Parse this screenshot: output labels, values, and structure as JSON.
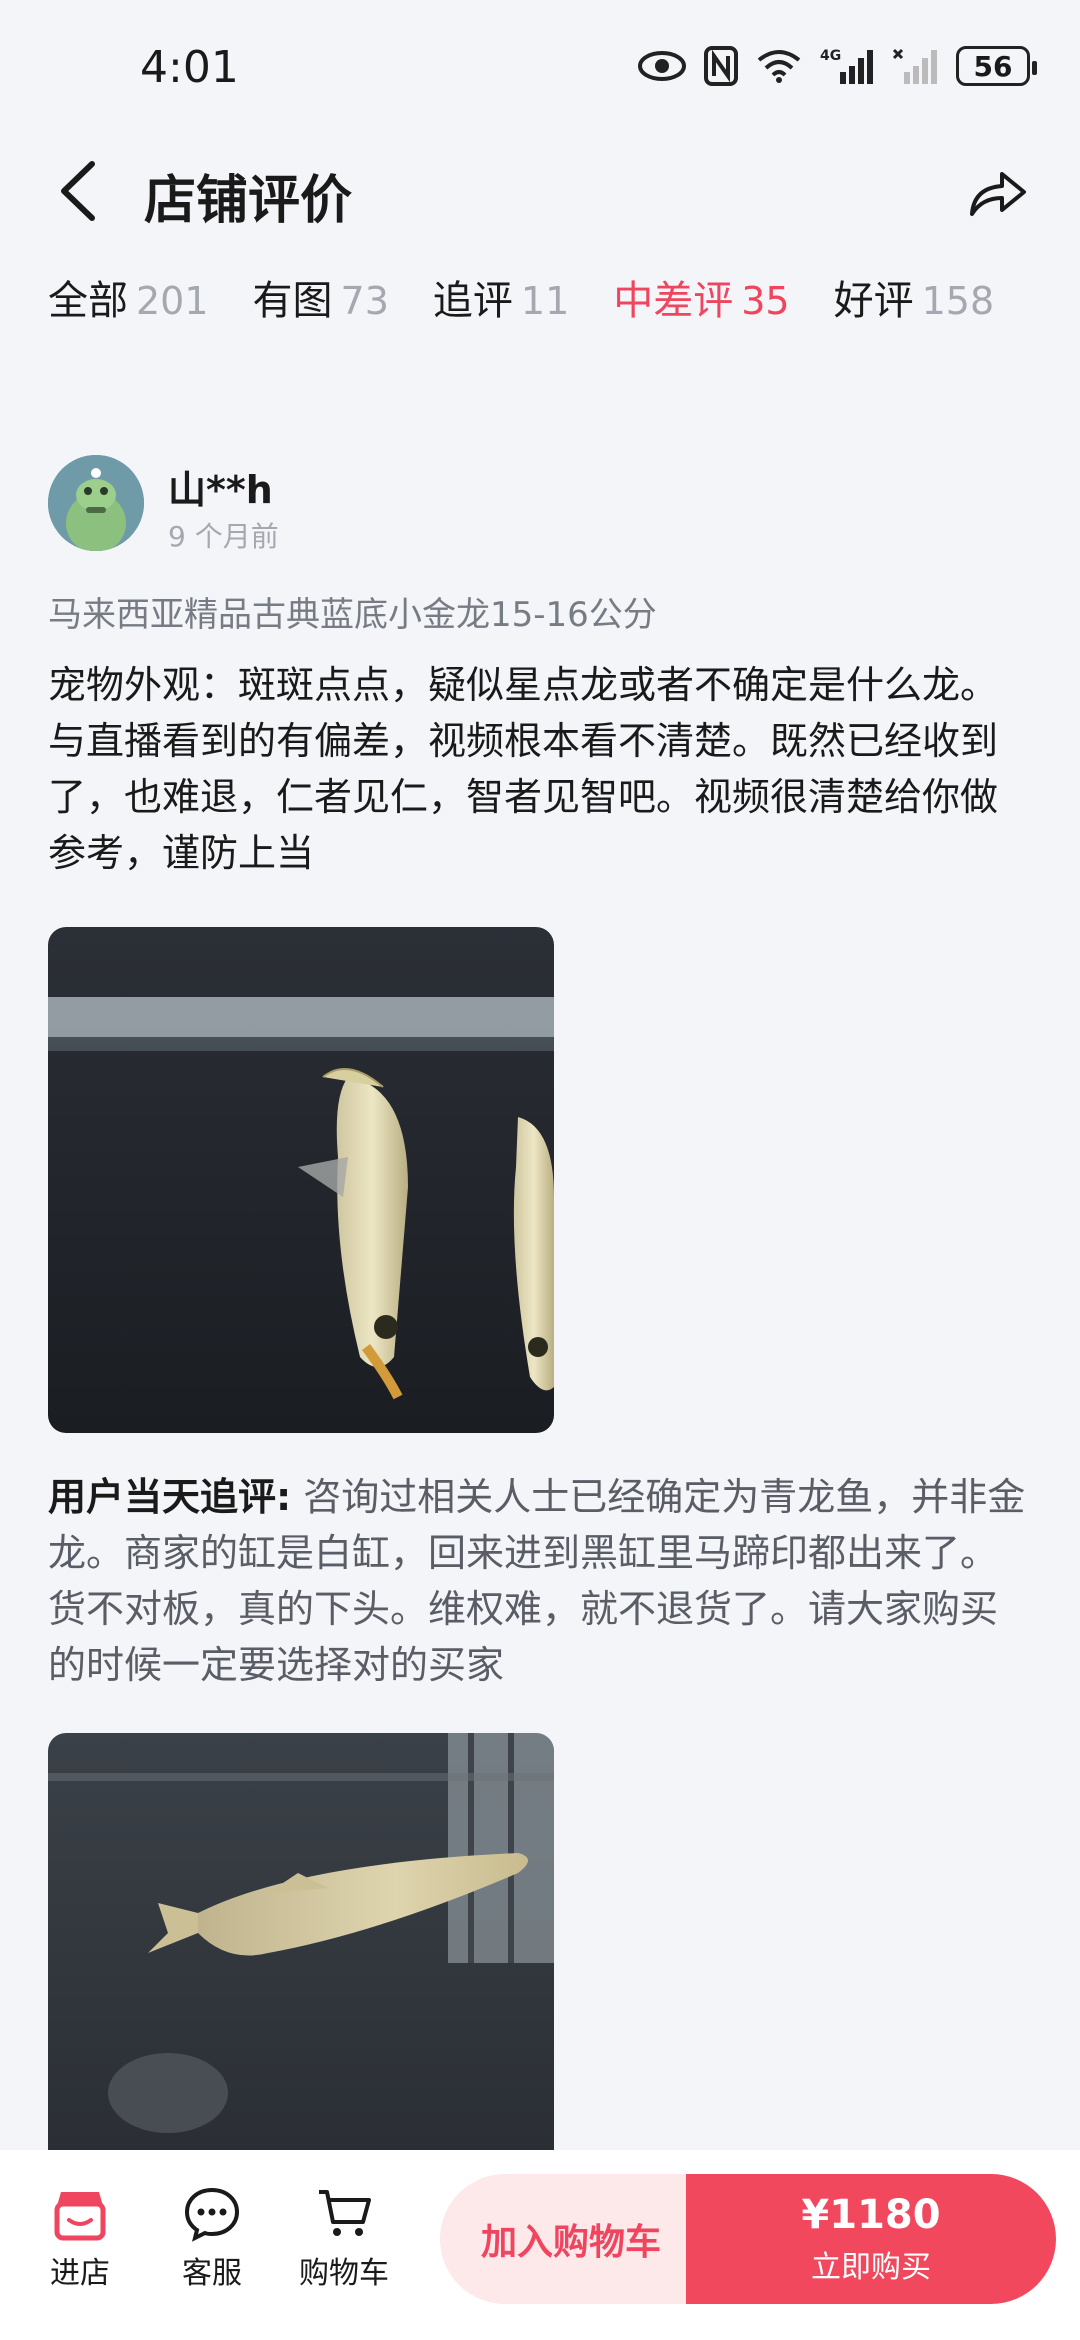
{
  "status_bar": {
    "time": "4:01",
    "battery": "56",
    "network": "4G"
  },
  "header": {
    "title": "店铺评价"
  },
  "tabs": [
    {
      "label": "全部",
      "count": "201"
    },
    {
      "label": "有图",
      "count": "73"
    },
    {
      "label": "追评",
      "count": "11"
    },
    {
      "label": "中差评",
      "count": "35",
      "active": true
    },
    {
      "label": "好评",
      "count": "158"
    }
  ],
  "review": {
    "username": "山**h",
    "time": "9 个月前",
    "sku": "马来西亚精品古典蓝底小金龙15-16公分",
    "content": "宠物外观：斑斑点点，疑似星点龙或者不确定是什么龙。与直播看到的有偏差，视频根本看不清楚。既然已经收到了，也难退，仁者见仁，智者见智吧。视频很清楚给你做参考，谨防上当",
    "followup_label": "用户当天追评:",
    "followup_text": " 咨询过相关人士已经确定为青龙鱼，并非金龙。商家的缸是白缸，回来进到黑缸里马蹄印都出来了。货不对板，真的下头。维权难，就不退货了。请大家购买的时候一定要选择对的买家"
  },
  "bottom_bar": {
    "store": "进店",
    "service": "客服",
    "cart": "购物车",
    "add_to_cart": "加入购物车",
    "price": "¥1180",
    "buy_now": "立即购买"
  },
  "colors": {
    "accent": "#f0455e",
    "background": "#f4f5f9"
  },
  "icons": [
    "eye-icon",
    "nfc-icon",
    "wifi-icon",
    "signal-icon",
    "battery-icon",
    "back-arrow-icon",
    "share-icon",
    "store-icon",
    "chat-icon",
    "cart-icon"
  ]
}
